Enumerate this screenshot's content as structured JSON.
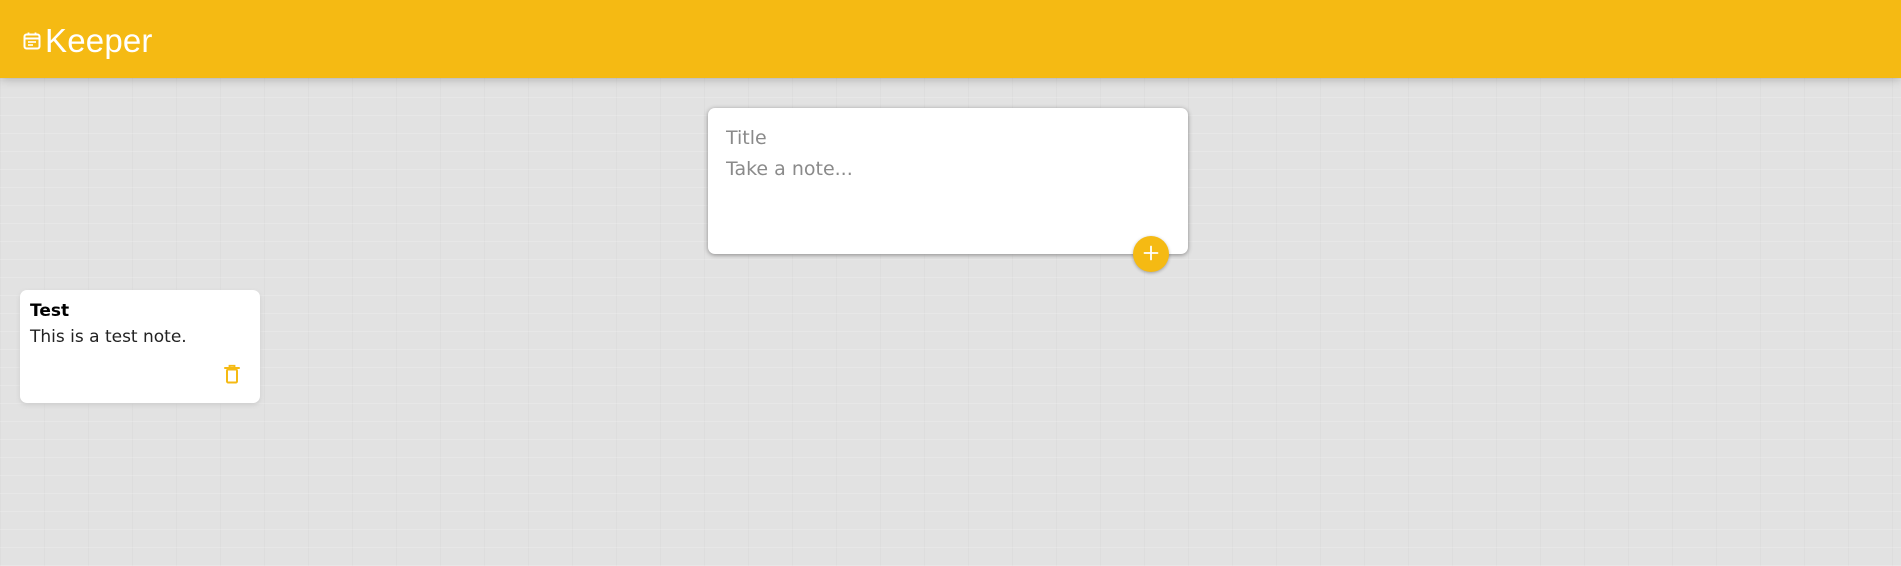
{
  "app": {
    "title": "Keeper",
    "logo_icon": "sticky-note-icon",
    "accent_color": "#f5ba13"
  },
  "create_note": {
    "title_placeholder": "Title",
    "title_value": "",
    "content_placeholder": "Take a note...",
    "content_value": "",
    "add_icon": "plus-icon"
  },
  "notes": [
    {
      "title": "Test",
      "content": "This is a test note.",
      "delete_icon": "trash-icon"
    }
  ]
}
